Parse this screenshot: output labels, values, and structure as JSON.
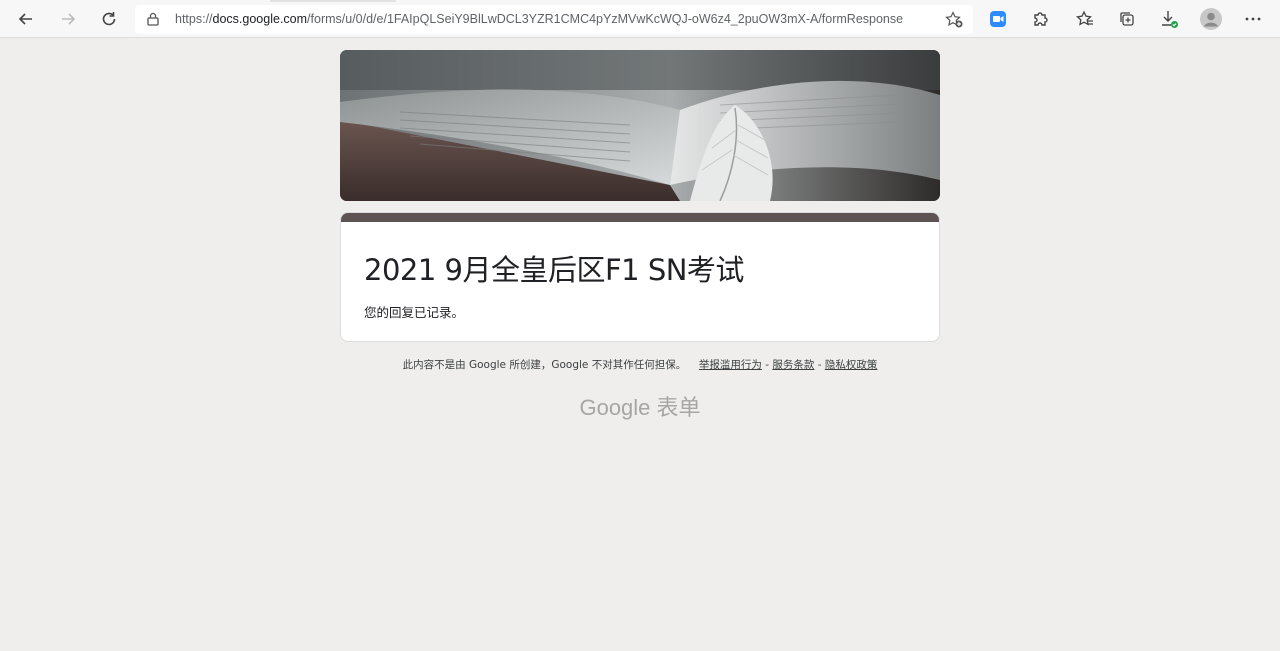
{
  "browser": {
    "url_host": "docs.google.com",
    "url_prefix": "https://",
    "url_path": "/forms/u/0/d/e/1FAIpQLSeiY9BlLwDCL3YZR1CMC4pYzMVwKcWQJ-oW6z4_2puOW3mX-A/formResponse",
    "icons": [
      "back-icon",
      "forward-icon",
      "refresh-icon",
      "lock-icon",
      "add-favorite-icon",
      "zoom-extension-icon",
      "extensions-icon",
      "favorites-icon",
      "collections-icon",
      "downloads-icon",
      "profile-icon",
      "more-icon"
    ]
  },
  "form": {
    "title": "2021 9月全皇后区F1 SN考试",
    "message": "您的回复已记录。",
    "accent_color": "#5c5352"
  },
  "footer": {
    "disclaimer": "此内容不是由 Google 所创建，Google 不对其作任何担保。",
    "report_link": "举报滥用行为",
    "sep1": " - ",
    "terms_link": "服务条款",
    "sep2": " - ",
    "privacy_link": "隐私权政策",
    "brand": "Google 表单"
  }
}
